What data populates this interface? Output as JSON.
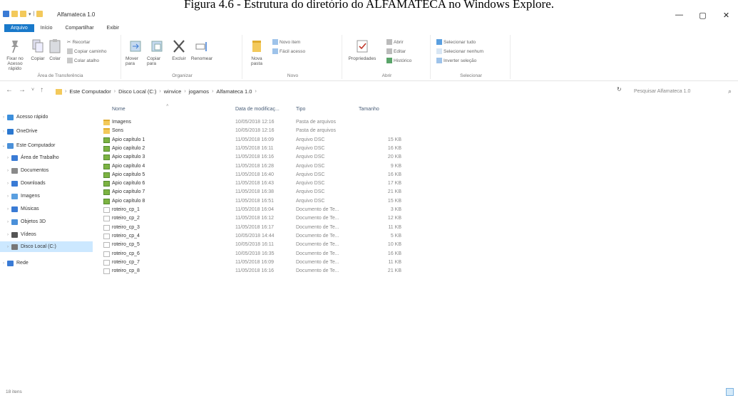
{
  "caption": "Figura 4.6 - Estrutura do diretório do ALFAMATECA no Windows Explore.",
  "window": {
    "title": "Alfamateca 1.0",
    "minimize": "—",
    "maximize": "▢",
    "close": "✕"
  },
  "tabs": [
    "Arquivo",
    "Início",
    "Compartilhar",
    "Exibir"
  ],
  "ribbon": {
    "clipboard": {
      "pin": "Fixar no Acesso rápido",
      "copy": "Copiar",
      "paste": "Colar",
      "cut": "Recortar",
      "copy_path": "Copiar caminho",
      "paste_shortcut": "Colar atalho",
      "label": "Área de Transferência"
    },
    "organize": {
      "move": "Mover para",
      "copy_to": "Copiar para",
      "delete": "Excluir",
      "rename": "Renomear",
      "label": "Organizar"
    },
    "new": {
      "new_folder": "Nova pasta",
      "new_item": "Novo item",
      "easy_access": "Fácil acesso",
      "label": "Novo"
    },
    "open": {
      "properties": "Propriedades",
      "open": "Abrir",
      "edit": "Editar",
      "history": "Histórico",
      "label": "Abrir"
    },
    "select": {
      "select_all": "Selecionar tudo",
      "select_none": "Selecionar nenhum",
      "invert": "Inverter seleção",
      "label": "Selecionar"
    }
  },
  "address": {
    "crumbs": [
      "Este Computador",
      "Disco Local (C:)",
      "winvice",
      "jogamos",
      "Alfamateca 1.0"
    ],
    "search_placeholder": "Pesquisar Alfamateca 1.0",
    "refresh": "↻"
  },
  "nav": [
    {
      "label": "Acesso rápido",
      "color": "#3c8fdc"
    },
    {
      "label": "OneDrive",
      "color": "#2b78d0"
    },
    {
      "label": "Este Computador",
      "color": "#4a90d9"
    },
    {
      "label": "Área de Trabalho",
      "color": "#3a7bd5"
    },
    {
      "label": "Documentos",
      "color": "#8a8a8a"
    },
    {
      "label": "Downloads",
      "color": "#3a7bd5"
    },
    {
      "label": "Imagens",
      "color": "#5a9fe0"
    },
    {
      "label": "Músicas",
      "color": "#3a7bd5"
    },
    {
      "label": "Objetos 3D",
      "color": "#4a90d9"
    },
    {
      "label": "Vídeos",
      "color": "#555555"
    },
    {
      "label": "Disco Local (C:)",
      "color": "#777777"
    },
    {
      "label": "Rede",
      "color": "#3a7bd5"
    }
  ],
  "columns": {
    "name": "Nome",
    "date": "Data de modificaç...",
    "type": "Tipo",
    "size": "Tamanho"
  },
  "files": [
    {
      "name": "Imagens",
      "date": "10/05/2018 12:16",
      "type": "Pasta de arquivos",
      "size": "",
      "kind": "folder"
    },
    {
      "name": "Sons",
      "date": "10/05/2018 12:16",
      "type": "Pasta de arquivos",
      "size": "",
      "kind": "folder"
    },
    {
      "name": "Apio capítulo 1",
      "date": "11/05/2018 16:09",
      "type": "Arquivo DSC",
      "size": "15 KB",
      "kind": "dsc"
    },
    {
      "name": "Apio capítulo 2",
      "date": "11/05/2018 16:11",
      "type": "Arquivo DSC",
      "size": "16 KB",
      "kind": "dsc"
    },
    {
      "name": "Apio capítulo 3",
      "date": "11/05/2018 16:16",
      "type": "Arquivo DSC",
      "size": "20 KB",
      "kind": "dsc"
    },
    {
      "name": "Apio capítulo 4",
      "date": "11/05/2018 16:28",
      "type": "Arquivo DSC",
      "size": "9 KB",
      "kind": "dsc"
    },
    {
      "name": "Apio capítulo 5",
      "date": "11/05/2018 16:40",
      "type": "Arquivo DSC",
      "size": "16 KB",
      "kind": "dsc"
    },
    {
      "name": "Apio capítulo 6",
      "date": "11/05/2018 16:43",
      "type": "Arquivo DSC",
      "size": "17 KB",
      "kind": "dsc"
    },
    {
      "name": "Apio capítulo 7",
      "date": "11/05/2018 16:38",
      "type": "Arquivo DSC",
      "size": "21 KB",
      "kind": "dsc"
    },
    {
      "name": "Apio capítulo 8",
      "date": "11/05/2018 16:51",
      "type": "Arquivo DSC",
      "size": "15 KB",
      "kind": "dsc"
    },
    {
      "name": "roteiro_cp_1",
      "date": "11/05/2018 16:04",
      "type": "Documento de Te...",
      "size": "3 KB",
      "kind": "doc"
    },
    {
      "name": "roteiro_cp_2",
      "date": "11/05/2018 16:12",
      "type": "Documento de Te...",
      "size": "12 KB",
      "kind": "doc"
    },
    {
      "name": "roteiro_cp_3",
      "date": "11/05/2018 16:17",
      "type": "Documento de Te...",
      "size": "11 KB",
      "kind": "doc"
    },
    {
      "name": "roteiro_cp_4",
      "date": "10/05/2018 14:44",
      "type": "Documento de Te...",
      "size": "5 KB",
      "kind": "doc"
    },
    {
      "name": "roteiro_cp_5",
      "date": "10/05/2018 16:11",
      "type": "Documento de Te...",
      "size": "10 KB",
      "kind": "doc"
    },
    {
      "name": "roteiro_cp_6",
      "date": "10/05/2018 16:35",
      "type": "Documento de Te...",
      "size": "16 KB",
      "kind": "doc"
    },
    {
      "name": "roteiro_cp_7",
      "date": "11/05/2018 16:09",
      "type": "Documento de Te...",
      "size": "11 KB",
      "kind": "doc"
    },
    {
      "name": "roteiro_cp_8",
      "date": "11/05/2018 16:16",
      "type": "Documento de Te...",
      "size": "21 KB",
      "kind": "doc"
    }
  ],
  "status": {
    "count": "18 itens"
  }
}
